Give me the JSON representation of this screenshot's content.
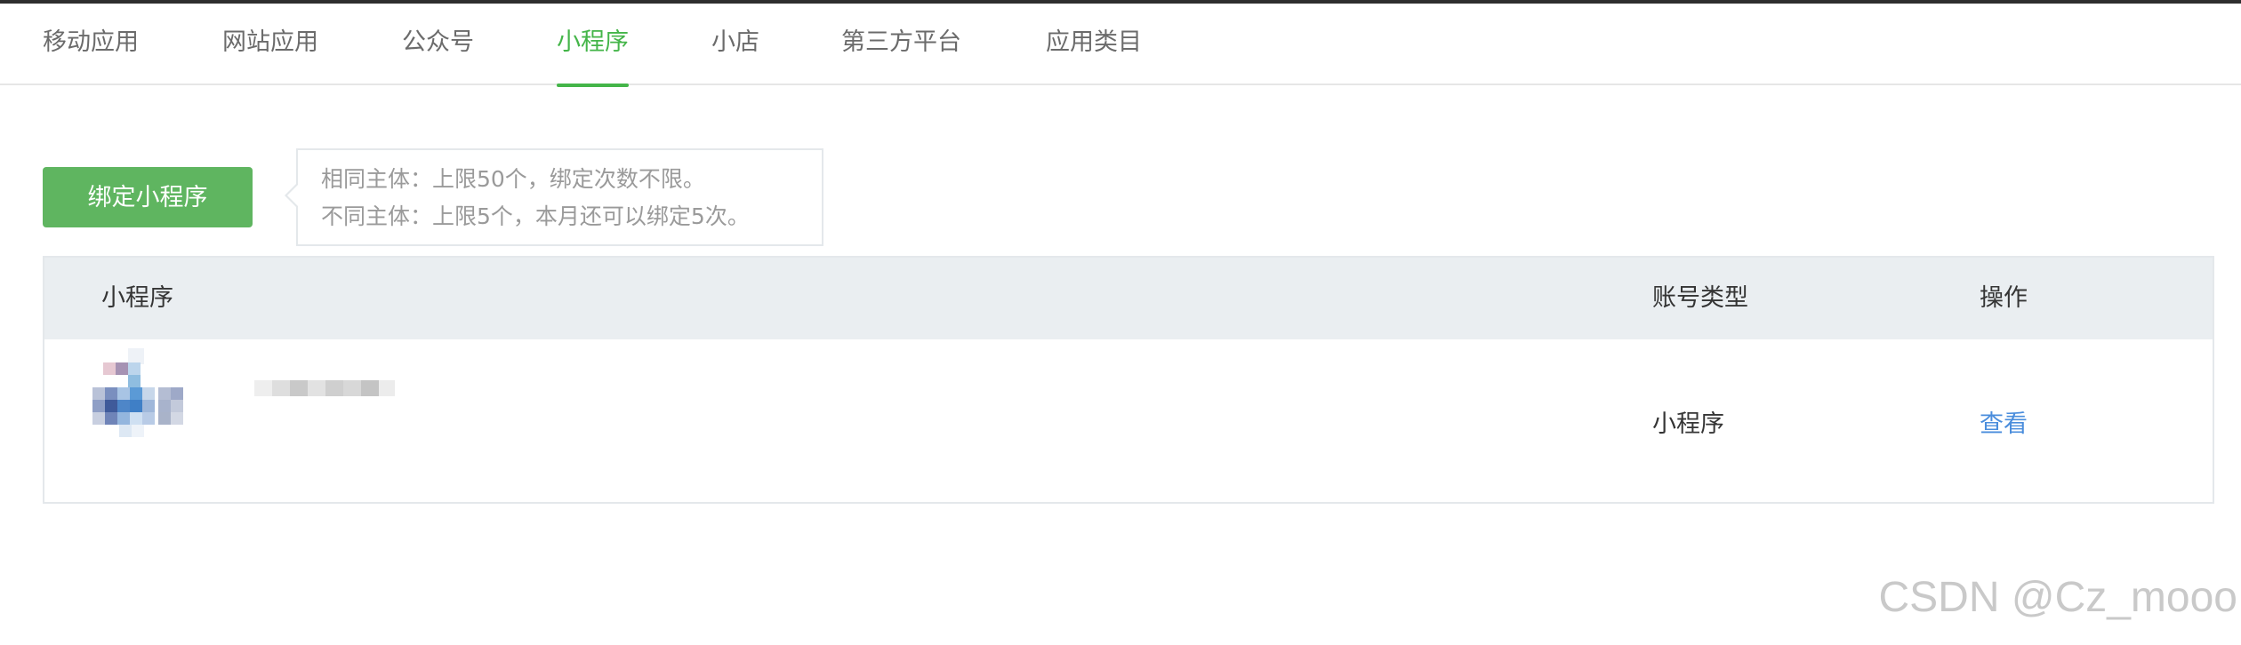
{
  "tabs": [
    {
      "label": "移动应用"
    },
    {
      "label": "网站应用"
    },
    {
      "label": "公众号"
    },
    {
      "label": "小程序",
      "active": true
    },
    {
      "label": "小店"
    },
    {
      "label": "第三方平台"
    },
    {
      "label": "应用类目"
    }
  ],
  "actions": {
    "bind_label": "绑定小程序"
  },
  "tip": {
    "line1": "相同主体：上限50个，绑定次数不限。",
    "line2": "不同主体：上限5个，本月还可以绑定5次。"
  },
  "table": {
    "headers": {
      "app": "小程序",
      "account_type": "账号类型",
      "operation": "操作"
    },
    "rows": [
      {
        "account_type": "小程序",
        "action": "查看"
      }
    ]
  },
  "watermark": "CSDN @Cz_mooo",
  "colors": {
    "accent": "#44b549",
    "button": "#5fb560",
    "link": "#4a8ddc"
  }
}
